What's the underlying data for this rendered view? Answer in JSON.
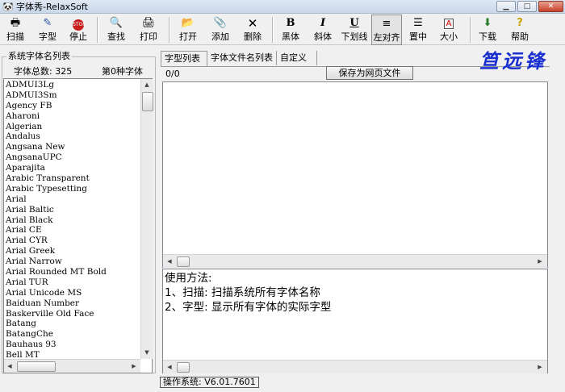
{
  "window": {
    "title": "字体秀-RelaxSoft"
  },
  "toolbar": {
    "scan": "扫描",
    "glyph": "字型",
    "stop": "停止",
    "find": "查找",
    "print": "打印",
    "open": "打开",
    "add": "添加",
    "delete": "删除",
    "bold": "黑体",
    "italic": "斜体",
    "underline": "下划线",
    "align_left": "左对齐",
    "center": "置中",
    "size": "大小",
    "download": "下载",
    "help": "帮助"
  },
  "left": {
    "group_title": "系统字体名列表",
    "total_label": "字体总数: 325",
    "index_label": "第0种字体",
    "fonts": [
      "ADMUI3Lg",
      "ADMUI3Sm",
      "Agency FB",
      "Aharoni",
      "Algerian",
      "Andalus",
      "Angsana New",
      "AngsanaUPC",
      "Aparajita",
      "Arabic Transparent",
      "Arabic Typesetting",
      "Arial",
      "Arial Baltic",
      "Arial Black",
      "Arial CE",
      "Arial CYR",
      "Arial Greek",
      "Arial Narrow",
      "Arial Rounded MT Bold",
      "Arial TUR",
      "Arial Unicode MS",
      "Baiduan Number",
      "Baskerville Old Face",
      "Batang",
      "BatangChe",
      "Bauhaus 93",
      "Bell MT"
    ]
  },
  "tabs": [
    "字型列表",
    "字体文件名列表",
    "自定义"
  ],
  "count": "0/0",
  "save_button": "保存为网页文件",
  "logo": "笪远锋",
  "help": {
    "title": "使用方法:",
    "line1": "1、扫描: 扫描系统所有字体名称",
    "line2": "2、字型: 显示所有字体的实际字型"
  },
  "status": {
    "os": "操作系统:  V6.01.7601"
  }
}
